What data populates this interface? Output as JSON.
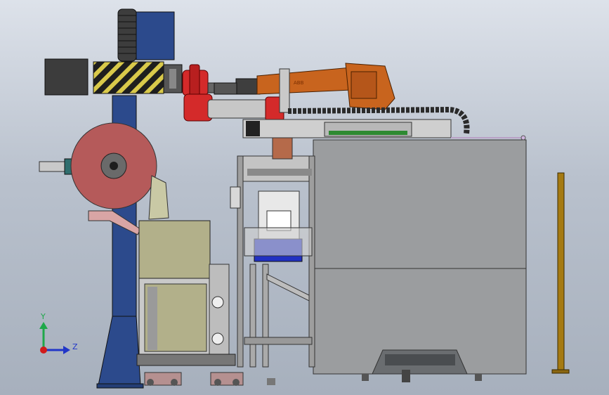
{
  "triad": {
    "y_label": "Y",
    "z_label": "Z",
    "colors": {
      "y_axis": "#1fa84a",
      "z_axis": "#2136c8",
      "x_axis": "#d11b1b"
    }
  },
  "robot_logo": "ABB",
  "colors": {
    "steel_blue": "#2c4a8c",
    "robot_orange": "#c8641e",
    "cobot_red": "#d42a2a",
    "reel_red": "#b55a5a",
    "cabinet_gray": "#9b9d9f",
    "cabinet_khaki": "#b2b08a",
    "post_gold": "#a57a12"
  }
}
